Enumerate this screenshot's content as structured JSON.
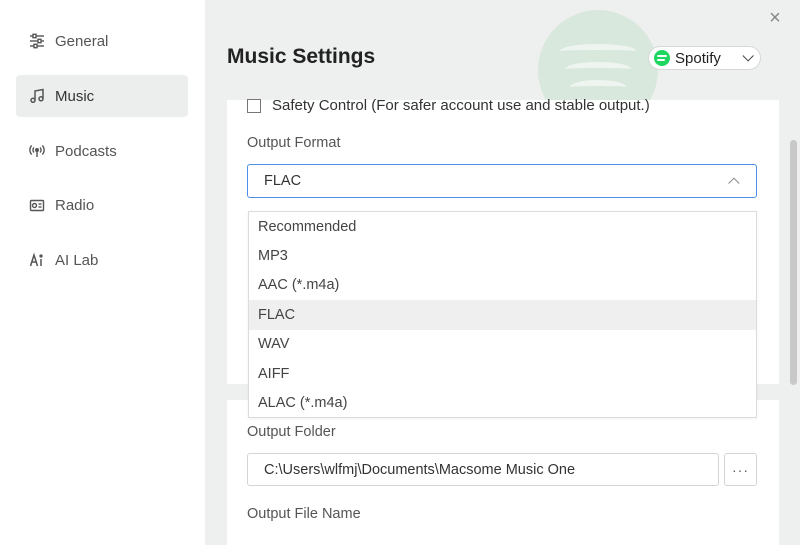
{
  "sidebar": {
    "items": [
      {
        "label": "General",
        "icon": "sliders-icon"
      },
      {
        "label": "Music",
        "icon": "music-note-icon",
        "active": true
      },
      {
        "label": "Podcasts",
        "icon": "broadcast-icon"
      },
      {
        "label": "Radio",
        "icon": "radio-icon"
      },
      {
        "label": "AI Lab",
        "icon": "ai-icon"
      }
    ]
  },
  "header": {
    "title": "Music Settings",
    "source": "Spotify",
    "source_color": "#1ed760",
    "close_symbol": "×"
  },
  "settings": {
    "safety_control_label": "Safety Control (For safer account use and stable output.)",
    "safety_control_checked": false,
    "output_format_label": "Output Format",
    "output_format_value": "FLAC",
    "output_format_options": [
      "Recommended",
      "MP3",
      "AAC (*.m4a)",
      "FLAC",
      "WAV",
      "AIFF",
      "ALAC (*.m4a)"
    ],
    "output_folder_label": "Output Folder",
    "output_folder_value": "C:\\Users\\wlfmj\\Documents\\Macsome Music One",
    "browse_label": "···",
    "output_file_name_label": "Output File Name"
  },
  "colors": {
    "accent_border": "#4d8fe6",
    "active_nav_bg": "#eceeee",
    "main_bg": "#eeefef"
  }
}
